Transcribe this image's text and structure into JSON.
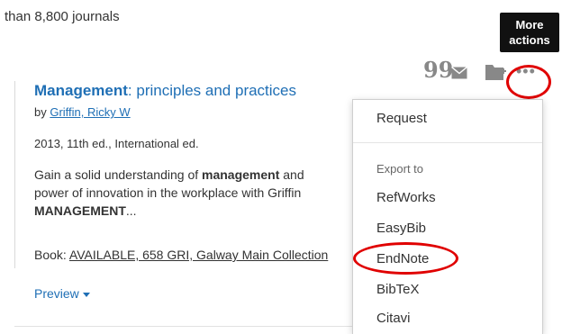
{
  "header": {
    "journals_text": "than 8,800 journals"
  },
  "tooltip": {
    "line1": "More",
    "line2": "actions"
  },
  "record": {
    "title_bold": "Management",
    "title_rest": ": principles and practices",
    "by_prefix": "by ",
    "author": "Griffin, Ricky W",
    "edition": "2013, 11th ed., International ed.",
    "description": {
      "line1_pre": "Gain a solid understanding of ",
      "line1_bold": "management",
      "line1_post": " and",
      "line2": "power of innovation in the workplace with Griffin",
      "line3_bold": "MANAGEMENT",
      "line3_post": "..."
    },
    "availability_prefix": "Book: ",
    "availability_link": "AVAILABLE, 658 GRI, Galway Main Collection",
    "preview_label": "Preview"
  },
  "actions": {
    "icons": [
      "quote-icon",
      "email-icon",
      "folder-icon",
      "more-actions-icon"
    ],
    "quote_glyph": "99",
    "more_glyph": "•••"
  },
  "menu": {
    "request": "Request",
    "export_label": "Export to",
    "items": [
      "RefWorks",
      "EasyBib",
      "EndNote",
      "BibTeX",
      "Citavi"
    ]
  },
  "colors": {
    "link": "#1f6fb5",
    "highlight": "#e00000",
    "tooltip_bg": "#111111",
    "icon_gray": "#888888"
  }
}
